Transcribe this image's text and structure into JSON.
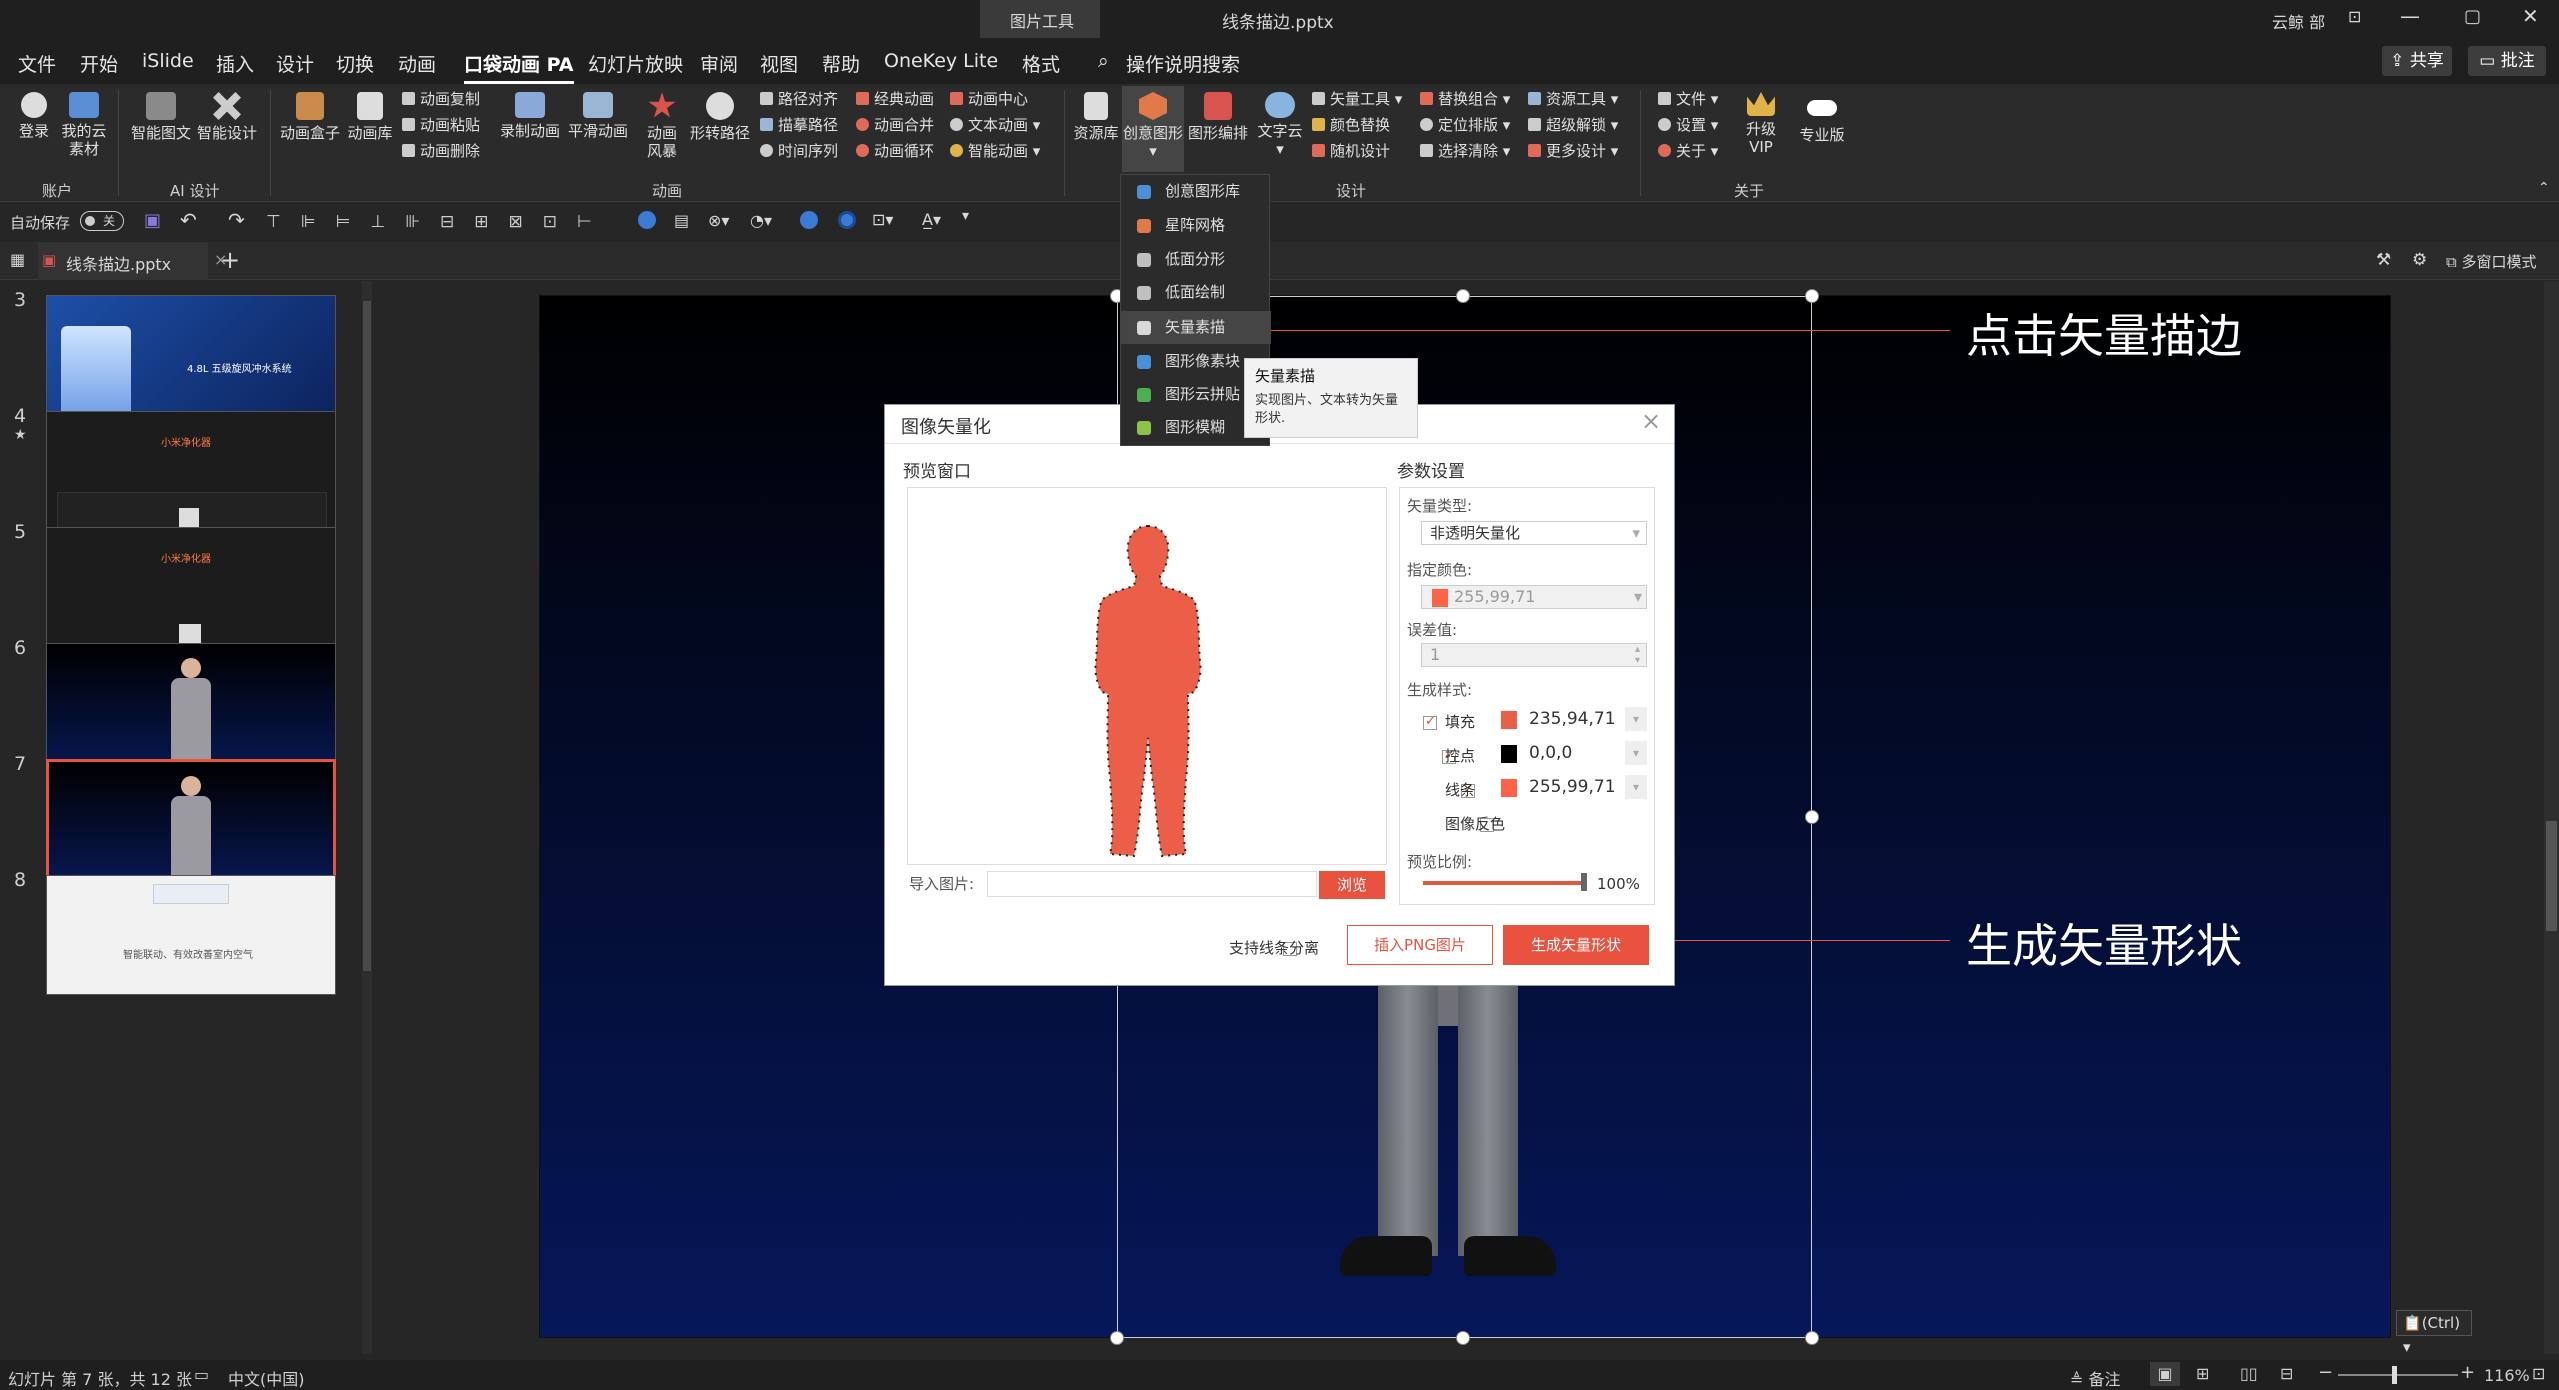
{
  "titlebar": {
    "context_tab": "图片工具",
    "filename": "线条描边.pptx",
    "user": "云鲸 部"
  },
  "menu": [
    "文件",
    "开始",
    "iSlide",
    "插入",
    "设计",
    "切换",
    "动画",
    "口袋动画 PA",
    "幻灯片放映",
    "审阅",
    "视图",
    "帮助",
    "OneKey Lite",
    "格式"
  ],
  "search": {
    "label": "操作说明搜索"
  },
  "share": {
    "share": "共享",
    "comment": "批注"
  },
  "ribbon": {
    "login": "登录",
    "cloud": "我的云素材",
    "smart_text": "智能图文",
    "smart_design": "智能设计",
    "anim_box": "动画盒子",
    "anim_lib": "动画库",
    "anim_copy": "动画复制",
    "anim_paste": "动画粘贴",
    "anim_delete": "动画删除",
    "record": "录制动画",
    "smooth": "平滑动画",
    "anim_style": "动画风暴",
    "shape_path": "形转路径",
    "path_align": "路径对齐",
    "trace_path": "描摹路径",
    "time_seq": "时间序列",
    "classic": "经典动画",
    "merge": "动画合并",
    "loop": "动画循环",
    "center": "动画中心",
    "text_anim": "文本动画",
    "smart_anim": "智能动画",
    "resource": "资源库",
    "creative": "创意图形",
    "shape_img": "图形编排",
    "word_cloud": "文字云",
    "vector": "矢量工具",
    "color_swap": "颜色替换",
    "random": "随机设计",
    "replace_group": "替换组合",
    "locate": "定位排版",
    "select_clear": "选择清除",
    "res_tool": "资源工具",
    "unlock": "超级解锁",
    "more": "更多设计",
    "file": "文件",
    "settings": "设置",
    "about": "关于",
    "vip": "升级VIP",
    "pro": "专业版",
    "groups": {
      "account": "账户",
      "ai": "AI 设计",
      "anim": "动画",
      "design": "设计",
      "about": "关于"
    }
  },
  "qat": {
    "autosave": "自动保存",
    "off": "关"
  },
  "tab": {
    "file": "线条描边.pptx",
    "multiwin": "多窗口模式"
  },
  "slides": [
    {
      "n": "3",
      "title": "4.8L 五级旋风冲水系统"
    },
    {
      "n": "4",
      "title": "小米净化器"
    },
    {
      "n": "5",
      "title": "小米净化器"
    },
    {
      "n": "6",
      "title": ""
    },
    {
      "n": "7",
      "title": ""
    },
    {
      "n": "8",
      "title": "智能联动、有效改善室内空气"
    }
  ],
  "dropdown": [
    "创意图形库",
    "星阵网格",
    "低面分形",
    "低面绘制",
    "矢量素描",
    "图形像素块",
    "图形云拼贴",
    "图形模糊"
  ],
  "tooltip": {
    "title": "矢量素描",
    "desc": "实现图片、文本转为矢量形状."
  },
  "dialog": {
    "title": "图像矢量化",
    "preview": "预览窗口",
    "params": "参数设置",
    "vtype_label": "矢量类型:",
    "vtype": "非透明矢量化",
    "color_label": "指定颜色:",
    "color": "255,99,71",
    "tol_label": "误差值:",
    "tol": "1",
    "style_label": "生成样式:",
    "fill": "填充",
    "fill_val": "235,94,71",
    "point": "控点",
    "point_val": "0,0,0",
    "line": "线条",
    "line_val": "255,99,71",
    "invert": "图像反色",
    "ratio_label": "预览比例:",
    "ratio": "100%",
    "import_label": "导入图片:",
    "browse": "浏览",
    "split": "支持线条分离",
    "insert_png": "插入PNG图片",
    "generate": "生成矢量形状"
  },
  "callouts": {
    "top": "点击矢量描边",
    "bottom": "生成矢量形状"
  },
  "status": {
    "slide": "幻灯片 第 7 张，共 12 张",
    "lang": "中文(中国)",
    "notes": "备注",
    "zoom": "116%",
    "ctrl": "(Ctrl)"
  },
  "colors": {
    "accent": "#e8523f",
    "shape": "#eb5e47"
  }
}
